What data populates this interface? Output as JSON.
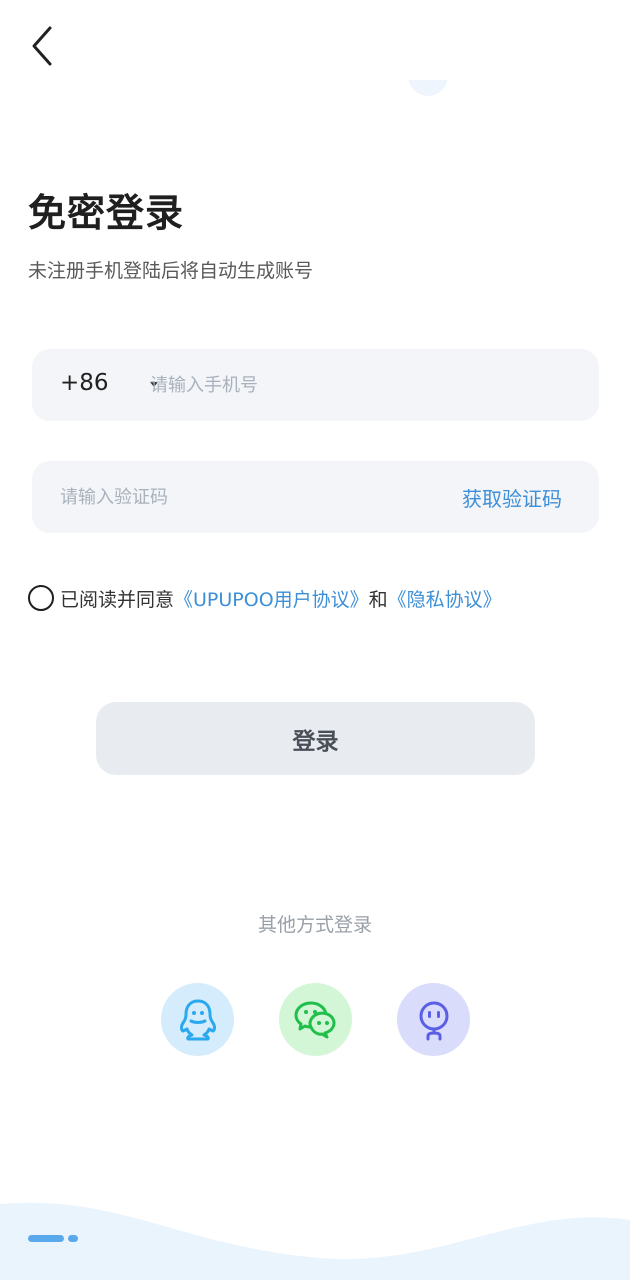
{
  "header": {
    "back_icon": "chevron-left-icon"
  },
  "page": {
    "title": "免密登录",
    "subtitle": "未注册手机登陆后将自动生成账号"
  },
  "phone_field": {
    "country_code": "+86",
    "caret_icon": "caret-down-icon",
    "placeholder": "请输入手机号",
    "value": ""
  },
  "code_field": {
    "placeholder": "请输入验证码",
    "value": "",
    "get_code_label": "获取验证码"
  },
  "agreement": {
    "checked": false,
    "prefix": "已阅读并同意",
    "user_agreement": "《UPUPOO用户协议》",
    "conjunction": "和",
    "privacy_policy": "《隐私协议》"
  },
  "login_button": {
    "label": "登录"
  },
  "other_login": {
    "label": "其他方式登录",
    "methods": [
      {
        "icon": "qq-icon",
        "color": "#d4ecfb"
      },
      {
        "icon": "wechat-icon",
        "color": "#d3f6d6"
      },
      {
        "icon": "robot-icon",
        "color": "#d9dcfa"
      }
    ]
  },
  "colors": {
    "accent": "#3d8fd8",
    "field_bg": "#f3f5f8",
    "button_bg": "#e8ebf0"
  }
}
